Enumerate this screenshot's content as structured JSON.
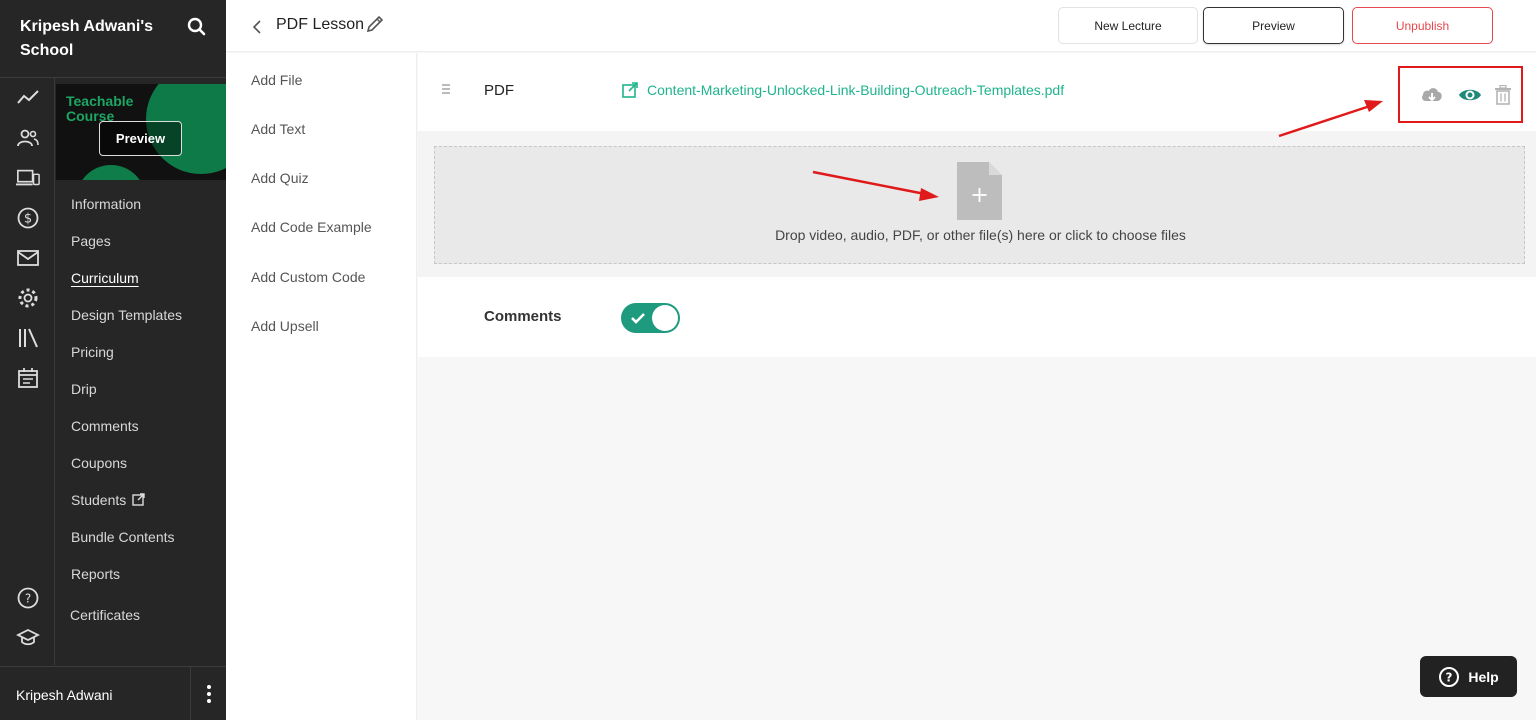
{
  "sidebar": {
    "school_name": "Kripesh Adwani's School",
    "course_thumb": {
      "title": "Teachable Course",
      "preview_label": "Preview"
    },
    "nav": [
      {
        "label": "Information"
      },
      {
        "label": "Pages"
      },
      {
        "label": "Curriculum",
        "active": true
      },
      {
        "label": "Design Templates"
      },
      {
        "label": "Pricing"
      },
      {
        "label": "Drip"
      },
      {
        "label": "Comments"
      },
      {
        "label": "Coupons"
      },
      {
        "label": "Students",
        "icon": "external-link-icon"
      },
      {
        "label": "Bundle Contents"
      },
      {
        "label": "Reports"
      },
      {
        "label": "Certificates"
      }
    ],
    "rail_icons": [
      "analytics-icon",
      "users-icon",
      "devices-icon",
      "dollar-icon",
      "mail-icon",
      "gear-icon",
      "library-icon",
      "calendar-icon",
      "help-circle-icon",
      "graduation-cap-icon"
    ],
    "user_name": "Kripesh Adwani"
  },
  "header": {
    "lesson_title": "PDF Lesson",
    "new_lecture_label": "New Lecture",
    "preview_label": "Preview",
    "unpublish_label": "Unpublish"
  },
  "add_panel": {
    "items": [
      "Add File",
      "Add Text",
      "Add Quiz",
      "Add Code Example",
      "Add Custom Code",
      "Add Upsell"
    ]
  },
  "file": {
    "type_label": "PDF",
    "file_name": "Content-Marketing-Unlocked-Link-Building-Outreach-Templates.pdf"
  },
  "dropzone": {
    "text": "Drop video, audio, PDF, or other file(s) here or click to choose files"
  },
  "comments": {
    "label": "Comments",
    "enabled": true
  },
  "help_label": "Help",
  "colors": {
    "sidebar_bg": "#262626",
    "accent_green": "#1fb48c",
    "toggle_green": "#1e9a7f",
    "danger_red": "#e5484d",
    "annotation_red": "#e01a1a"
  }
}
